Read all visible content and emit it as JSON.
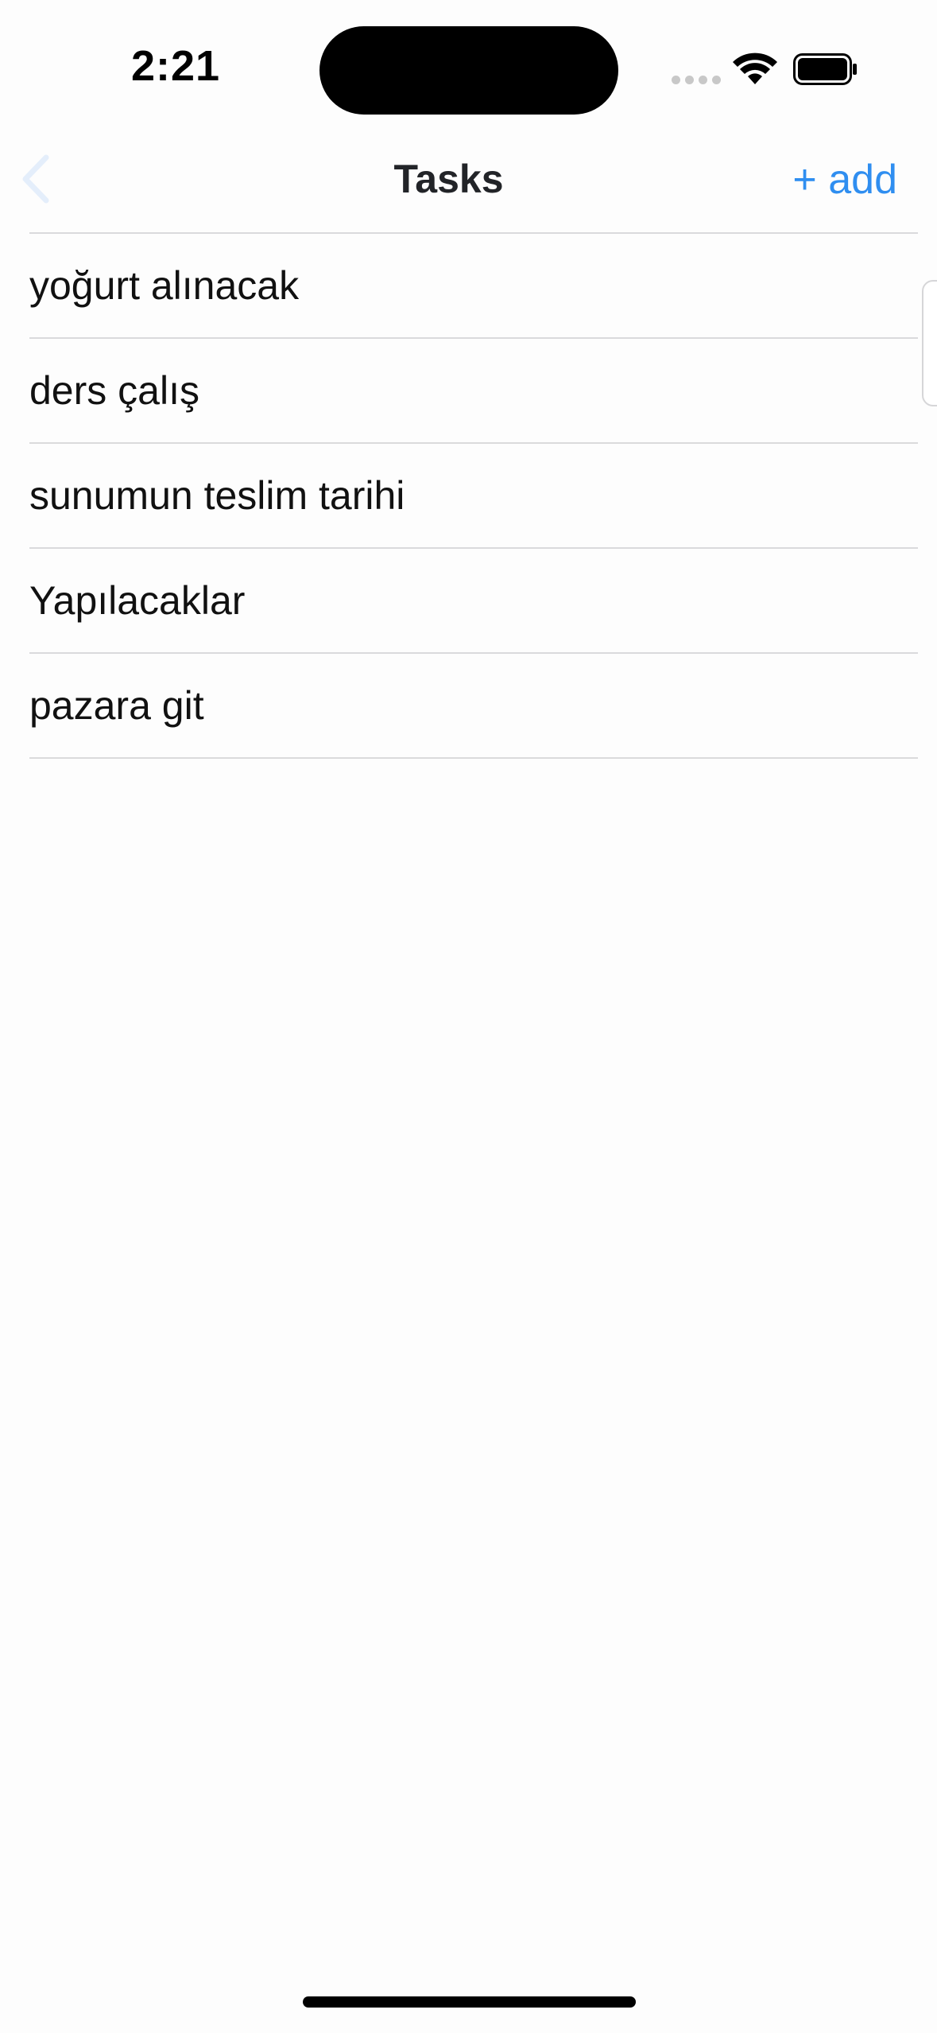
{
  "status_bar": {
    "time": "2:21",
    "icons": [
      "cellular-dots-icon",
      "wifi-icon",
      "battery-icon"
    ]
  },
  "nav": {
    "back_icon": "chevron-left-icon",
    "title": "Tasks",
    "add_label": "+ add"
  },
  "tasks": [
    {
      "label": "yoğurt alınacak"
    },
    {
      "label": "ders çalış"
    },
    {
      "label": "sunumun teslim tarihi"
    },
    {
      "label": "Yapılacaklar"
    },
    {
      "label": "pazara git"
    }
  ],
  "colors": {
    "accent": "#2f8ef0",
    "separator": "#dadadc",
    "background": "#fdfdfd"
  }
}
